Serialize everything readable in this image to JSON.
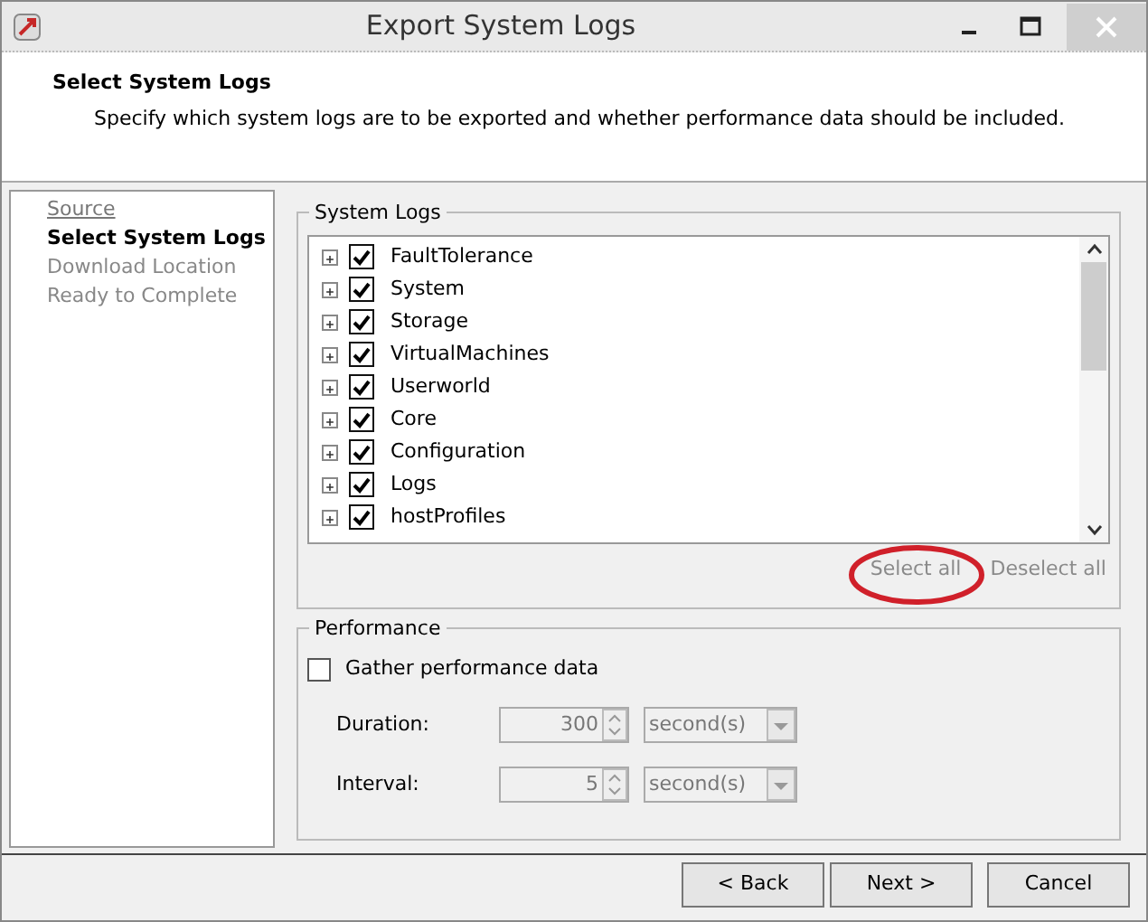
{
  "window": {
    "title": "Export System Logs"
  },
  "header": {
    "title": "Select System Logs",
    "subtitle": "Specify which system logs are to be exported and whether performance data should be included."
  },
  "steps": [
    {
      "label": "Source",
      "kind": "link"
    },
    {
      "label": "Select System Logs",
      "kind": "current"
    },
    {
      "label": "Download Location",
      "kind": "pending"
    },
    {
      "label": "Ready to Complete",
      "kind": "pending"
    }
  ],
  "system_logs": {
    "title": "System Logs",
    "items": [
      {
        "label": "FaultTolerance",
        "checked": true,
        "expanded": false
      },
      {
        "label": "System",
        "checked": true,
        "expanded": false
      },
      {
        "label": "Storage",
        "checked": true,
        "expanded": false
      },
      {
        "label": "VirtualMachines",
        "checked": true,
        "expanded": false
      },
      {
        "label": "Userworld",
        "checked": true,
        "expanded": false
      },
      {
        "label": "Core",
        "checked": true,
        "expanded": false
      },
      {
        "label": "Configuration",
        "checked": true,
        "expanded": false
      },
      {
        "label": "Logs",
        "checked": true,
        "expanded": false
      },
      {
        "label": "hostProfiles",
        "checked": true,
        "expanded": false
      }
    ],
    "actions": [
      {
        "label": "Select all",
        "disabled": true,
        "circled": true
      },
      {
        "label": "Deselect all",
        "disabled": true,
        "circled": false
      }
    ]
  },
  "performance": {
    "title": "Performance",
    "gather": {
      "label": "Gather performance data",
      "checked": false
    },
    "fields": [
      {
        "label": "Duration:",
        "value": "300",
        "unit": "second(s)",
        "disabled": true
      },
      {
        "label": "Interval:",
        "value": "5",
        "unit": "second(s)",
        "disabled": true
      }
    ]
  },
  "buttons": [
    {
      "label": "< Back"
    },
    {
      "label": "Next >"
    },
    {
      "label": "Cancel"
    }
  ]
}
